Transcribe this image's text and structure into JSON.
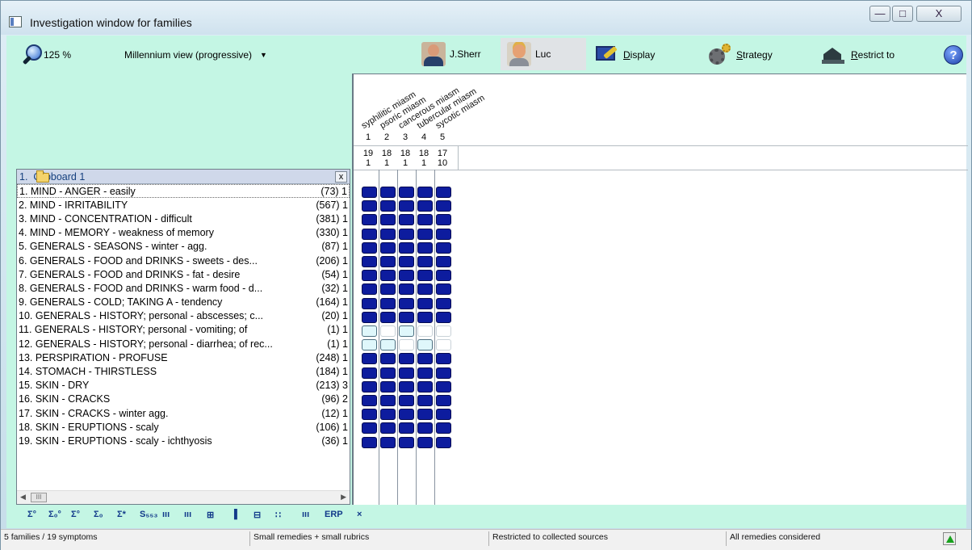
{
  "window": {
    "title": "Investigation window for families",
    "minimize": "—",
    "maximize": "□",
    "close": "X"
  },
  "toolbar": {
    "zoom": "125 %",
    "view_mode": "Millennium view (progressive)",
    "user1": "J.Sherr",
    "user2": "Luc",
    "display_prefix": "D",
    "display_rest": "isplay",
    "strategy_prefix": "S",
    "strategy_rest": "trategy",
    "restrict_prefix": "R",
    "restrict_rest": "estrict to",
    "help": "?"
  },
  "clipboard": {
    "title": "1.  Clipboard 1",
    "close": "x",
    "rubrics": [
      {
        "text": "1. MIND - ANGER - easily",
        "count": "(73) 1"
      },
      {
        "text": "2. MIND - IRRITABILITY",
        "count": "(567) 1"
      },
      {
        "text": "3. MIND - CONCENTRATION - difficult",
        "count": "(381) 1"
      },
      {
        "text": "4. MIND - MEMORY - weakness of memory",
        "count": "(330) 1"
      },
      {
        "text": "5. GENERALS - SEASONS - winter - agg.",
        "count": "(87) 1"
      },
      {
        "text": "6. GENERALS - FOOD and DRINKS - sweets - des...",
        "count": "(206) 1"
      },
      {
        "text": "7. GENERALS - FOOD and DRINKS - fat - desire",
        "count": "(54) 1"
      },
      {
        "text": "8. GENERALS - FOOD and DRINKS - warm food - d...",
        "count": "(32) 1"
      },
      {
        "text": "9. GENERALS - COLD; TAKING A - tendency",
        "count": "(164) 1"
      },
      {
        "text": "10. GENERALS - HISTORY; personal - abscesses; c...",
        "count": "(20) 1"
      },
      {
        "text": "11. GENERALS - HISTORY; personal - vomiting; of",
        "count": "(1) 1"
      },
      {
        "text": "12. GENERALS - HISTORY; personal - diarrhea; of rec...",
        "count": "(1) 1"
      },
      {
        "text": "13. PERSPIRATION - PROFUSE",
        "count": "(248) 1"
      },
      {
        "text": "14. STOMACH - THIRSTLESS",
        "count": "(184) 1"
      },
      {
        "text": "15. SKIN - DRY",
        "count": "(213) 3"
      },
      {
        "text": "16. SKIN - CRACKS",
        "count": "(96) 2"
      },
      {
        "text": "17. SKIN - CRACKS - winter agg.",
        "count": "(12) 1"
      },
      {
        "text": "18. SKIN - ERUPTIONS - scaly",
        "count": "(106) 1"
      },
      {
        "text": "19. SKIN - ERUPTIONS - scaly - ichthyosis",
        "count": "(36) 1"
      }
    ],
    "scroll_thumb": "III"
  },
  "families": [
    {
      "name": "syphilitic miasm",
      "index": "1",
      "stat1": "19",
      "stat2": "1"
    },
    {
      "name": "psoric miasm",
      "index": "2",
      "stat1": "18",
      "stat2": "1"
    },
    {
      "name": "cancerous miasm",
      "index": "3",
      "stat1": "18",
      "stat2": "1"
    },
    {
      "name": "tubercular miasm",
      "index": "4",
      "stat1": "18",
      "stat2": "1"
    },
    {
      "name": "sycotic miasm",
      "index": "5",
      "stat1": "17",
      "stat2": "10"
    }
  ],
  "grid": {
    "legend": {
      "F": "full",
      "L": "light",
      "E": "empty"
    },
    "rows": [
      "FFFFF",
      "FFFFF",
      "FFFFF",
      "FFFFF",
      "FFFFF",
      "FFFFF",
      "FFFFF",
      "FFFFF",
      "FFFFF",
      "FFFFF",
      "LELEE",
      "LLELE",
      "FFFFF",
      "FFFFF",
      "FFFFF",
      "FFFFF",
      "FFFFF",
      "FFFFF",
      "FFFFF"
    ]
  },
  "bottom_toolbar": {
    "icons": [
      "Σ°",
      "Σ₀°",
      "Σ°",
      "Σ₀",
      "Σ*",
      "S₅₅₃",
      "ııı",
      "ııı",
      "⊞",
      "▐",
      "⊟",
      "∷",
      "ııı",
      "ERP",
      "×"
    ]
  },
  "status": {
    "families": "5 families / 19 symptoms",
    "filter": "Small remedies + small rubrics",
    "sources": "Restricted to collected sources",
    "remedies": "All remedies considered"
  }
}
